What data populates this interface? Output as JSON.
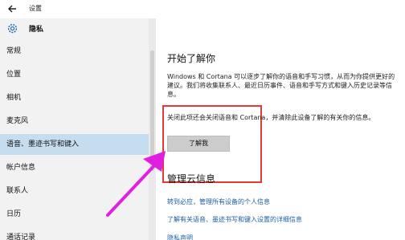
{
  "window": {
    "title": "设置"
  },
  "section": {
    "title": "隐私"
  },
  "sidebar": {
    "items": [
      {
        "label": "常规"
      },
      {
        "label": "位置"
      },
      {
        "label": "相机"
      },
      {
        "label": "麦克风"
      },
      {
        "label": "语音、墨迹书写和键入",
        "selected": true
      },
      {
        "label": "帐户信息"
      },
      {
        "label": "联系人"
      },
      {
        "label": "日历"
      },
      {
        "label": "通话记录"
      }
    ]
  },
  "main": {
    "start_heading": "开始了解你",
    "start_description": "Windows 和 Cortana 可以逐步了解你的语音和手写习惯，从而为你提供更好的建议。我们将收集联系人、最近日历事件、语音和手写方式和键入历史记录等信息。",
    "turnoff_text": "关闭此项还会关闭语音和 Cortana，并清除此设备了解的有关你的信息。",
    "learn_button": "了解我",
    "cloud_heading": "管理云信息",
    "links": [
      "转到必应，管理所有设备的个人信息",
      "了解有关语音、墨迹书写和键入设置的详细信息",
      "隐私声明"
    ]
  },
  "colors": {
    "selected_bg": "#c6dcef",
    "link": "#1d5ea8",
    "highlight": "#e53935",
    "arrow": "#e020e0"
  },
  "icons": [
    "back-arrow-icon",
    "gear-icon"
  ]
}
